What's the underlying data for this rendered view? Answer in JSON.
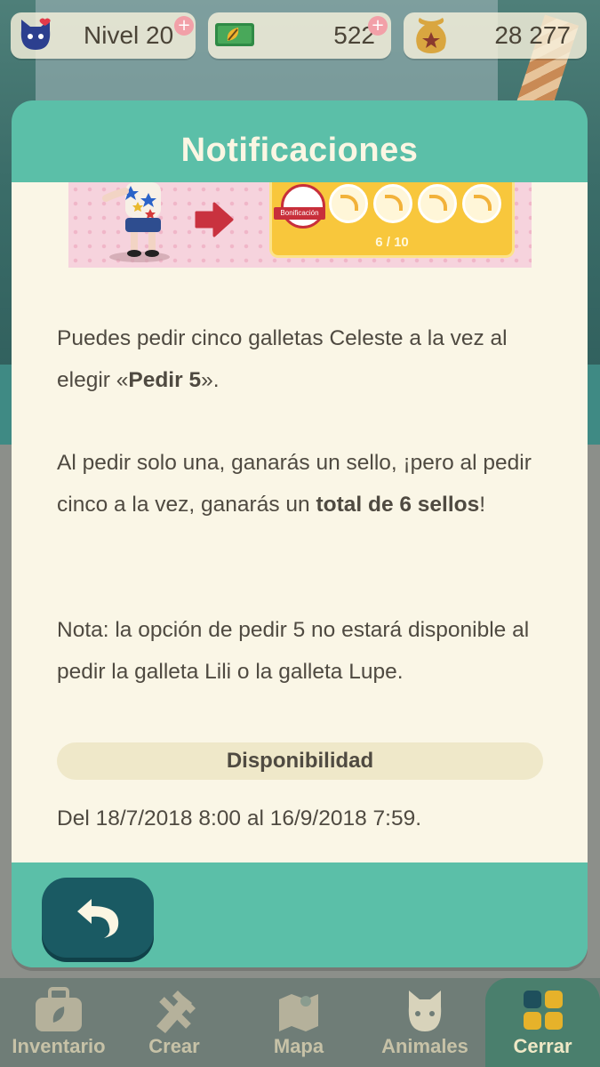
{
  "hud": {
    "level": "Nivel 20",
    "tickets": "522",
    "bells": "28 277",
    "plus_symbol": "+"
  },
  "modal": {
    "title": "Notificaciones",
    "banner": {
      "stamp_count": "6 / 10",
      "bonus_label": "Bonificación"
    },
    "paragraph1_a": "Puedes pedir cinco galletas Celeste a la vez al elegir «",
    "paragraph1_bold": "Pedir 5",
    "paragraph1_b": "».",
    "paragraph2_a": "Al pedir solo una, ganarás un sello, ¡pero al pedir cinco a la vez, ganarás un ",
    "paragraph2_bold": "total de 6 sellos",
    "paragraph2_b": "!",
    "paragraph3": "Nota: la opción de pedir 5 no estará disponible al pedir la galleta Lili o la galleta Lupe.",
    "availability_heading": "Disponibilidad",
    "availability_dates": "Del 18/7/2018 8:00 al 16/9/2018 7:59."
  },
  "nav": {
    "items": [
      {
        "label": "Inventario",
        "icon": "suitcase-icon"
      },
      {
        "label": "Crear",
        "icon": "hammer-saw-icon"
      },
      {
        "label": "Mapa",
        "icon": "map-icon"
      },
      {
        "label": "Animales",
        "icon": "cat-face-icon"
      },
      {
        "label": "Cerrar",
        "icon": "grid-icon"
      }
    ]
  },
  "colors": {
    "modal_teal": "#5bbfa8",
    "body_cream": "#faf6e6",
    "back_button": "#1a5a63",
    "text": "#4f4a41"
  }
}
